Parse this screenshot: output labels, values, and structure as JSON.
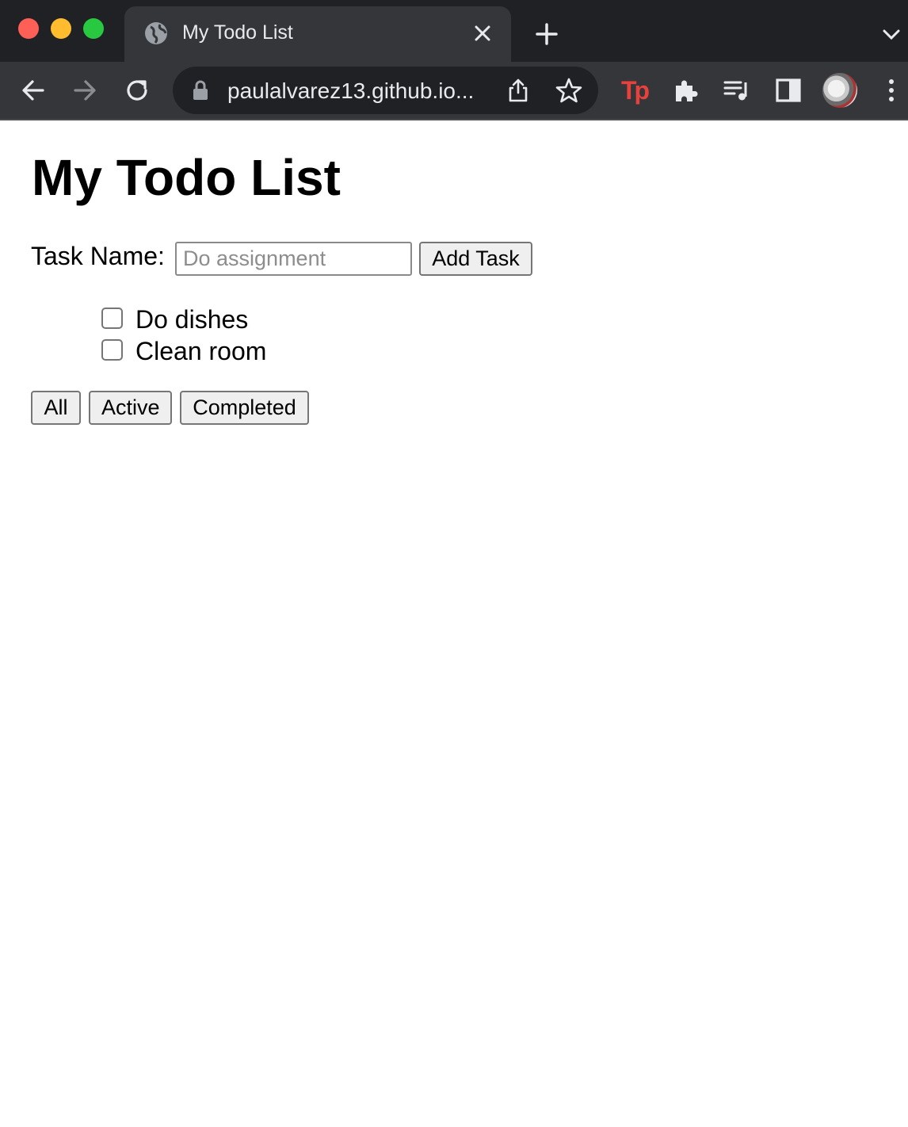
{
  "browser": {
    "tab": {
      "title": "My Todo List",
      "favicon": "globe-icon",
      "close_icon": "close-icon"
    },
    "new_tab_icon": "plus-icon",
    "tab_search_icon": "chevron-down-icon",
    "nav": {
      "back": "arrow-left-icon",
      "forward": "arrow-right-icon",
      "reload": "reload-icon"
    },
    "omnibox": {
      "url": "paulalvarez13.github.io...",
      "lock_icon": "lock-icon",
      "share_icon": "share-icon",
      "bookmark_icon": "star-icon"
    },
    "extensions": {
      "tp_label": "Tp",
      "puzzle_icon": "puzzle-icon",
      "media_icon": "media-queue-icon",
      "sidepanel_icon": "side-panel-icon"
    },
    "profile_icon": "avatar",
    "menu_icon": "more-vert-icon",
    "colors": {
      "frame": "#202124",
      "toolbar": "#35363a",
      "tp_accent": "#e8413c"
    }
  },
  "page": {
    "title": "My Todo List",
    "form": {
      "label": "Task Name:",
      "input_value": "",
      "input_placeholder": "Do assignment",
      "add_button": "Add Task"
    },
    "todos": [
      {
        "label": "Do dishes",
        "checked": false
      },
      {
        "label": "Clean room",
        "checked": false
      }
    ],
    "filters": {
      "all": "All",
      "active": "Active",
      "completed": "Completed"
    }
  }
}
